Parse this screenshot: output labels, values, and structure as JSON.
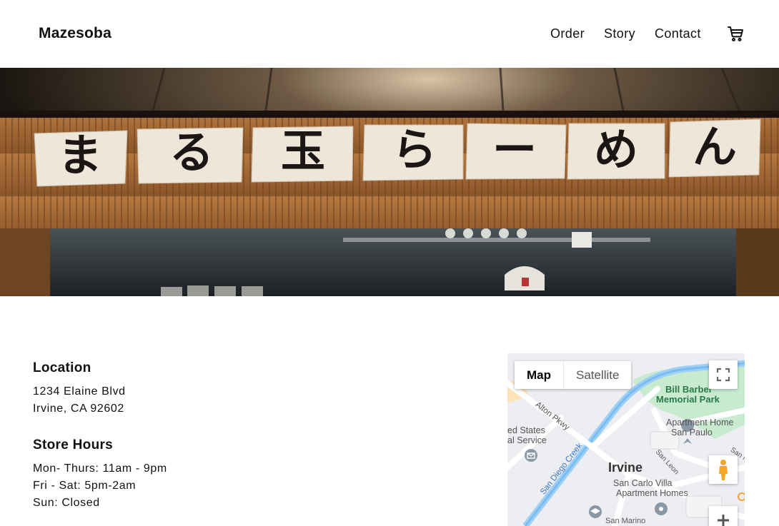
{
  "header": {
    "brand": "Mazesoba",
    "nav": {
      "order": "Order",
      "story": "Story",
      "contact": "Contact"
    },
    "cart_icon": "cart-icon"
  },
  "hero": {
    "sign_chars": [
      "ま",
      "る",
      "玉",
      "ら",
      "ー",
      "め",
      "ん"
    ]
  },
  "location": {
    "title": "Location",
    "address_line1": "1234 Elaine Blvd",
    "address_line2": "Irvine, CA 92602"
  },
  "hours": {
    "title": "Store Hours",
    "line1": "Mon- Thurs: 11am - 9pm",
    "line2": "Fri - Sat: 5pm-2am",
    "line3": "Sun: Closed"
  },
  "map": {
    "type_map": "Map",
    "type_satellite": "Satellite",
    "labels": {
      "park1": "Bill Barber",
      "park2": "Memorial Park",
      "apt1a": "San Paulo",
      "apt1b": "Apartment Home",
      "alton": "Alton Pkwy",
      "usps1": "ed States",
      "usps2": "al Service",
      "creek": "San Diego Creek",
      "sanleon": "San Leon",
      "sanmar": "San Mar",
      "city": "Irvine",
      "apt2a": "San Carlo Villa",
      "apt2b": "Apartment Homes",
      "sanmarino": "San Marino"
    },
    "colors": {
      "park": "#c8ebd0",
      "water": "#9ecff5",
      "road": "#ffffff",
      "land": "#eceef1"
    }
  }
}
